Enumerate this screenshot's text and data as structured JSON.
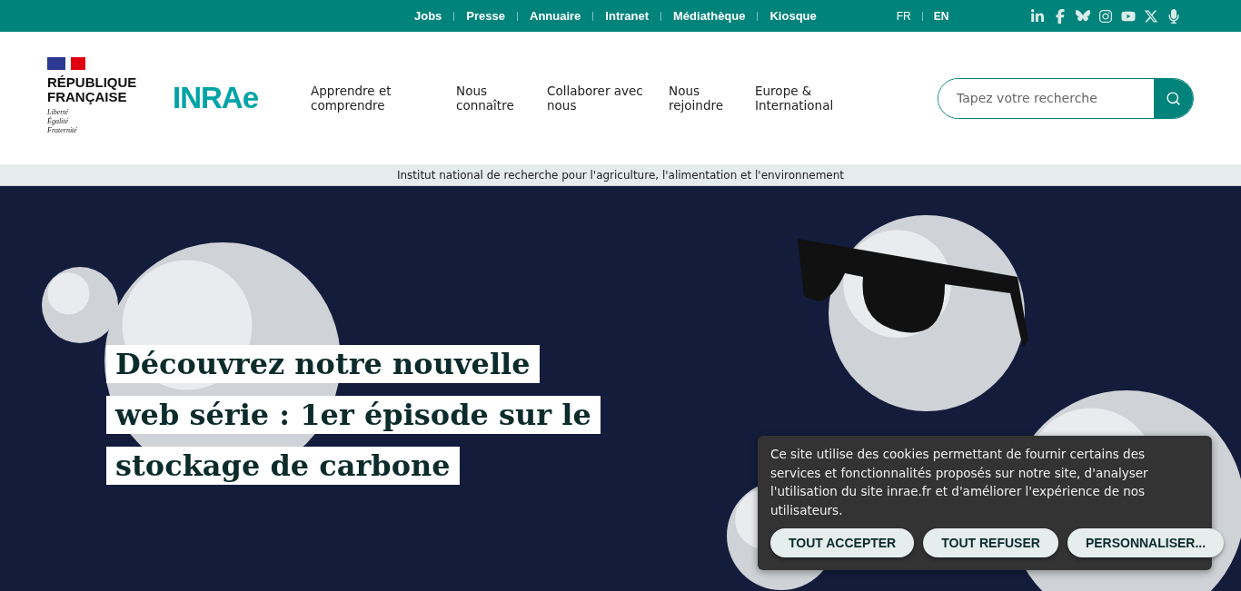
{
  "top_bar": {
    "links": [
      "Jobs",
      "Presse",
      "Annuaire",
      "Intranet",
      "Médiathèque",
      "Kiosque"
    ],
    "languages": [
      {
        "label": "FR",
        "selected": false
      },
      {
        "label": "EN",
        "selected": true
      }
    ],
    "social": [
      {
        "kind": "linkedin"
      },
      {
        "kind": "facebook"
      },
      {
        "kind": "bluesky"
      },
      {
        "kind": "instagram"
      },
      {
        "kind": "youtube"
      },
      {
        "kind": "x"
      },
      {
        "kind": "podcast"
      }
    ]
  },
  "header": {
    "republic": {
      "name_lines": [
        "RÉPUBLIQUE",
        "FRANÇAISE"
      ],
      "motto": [
        "Liberté",
        "Égalité",
        "Fraternité"
      ]
    },
    "logo": "INRAe",
    "nav": [
      "Apprendre et comprendre",
      "Nous connaître",
      "Collaborer avec nous",
      "Nous rejoindre",
      "Europe & International"
    ],
    "search": {
      "placeholder": "Tapez votre recherche"
    }
  },
  "tagline": "Institut national de recherche pour l'agriculture, l'alimentation et l'environnement",
  "hero": {
    "title": "Découvrez notre nouvelle web série : 1er épisode sur le stockage de carbone"
  },
  "cookie_banner": {
    "text": "Ce site utilise des cookies permettant de fournir certains des services et fonctionnalités proposés sur notre site, d'analyser l'utilisation du site inrae.fr et d'améliorer l'expérience de nos utilisateurs.",
    "buttons": [
      "TOUT ACCEPTER",
      "TOUT REFUSER",
      "PERSONNALISER..."
    ]
  }
}
